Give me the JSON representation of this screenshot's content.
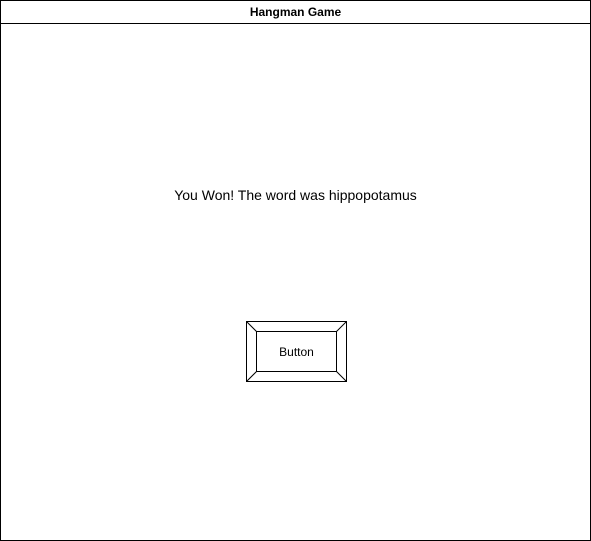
{
  "window": {
    "title": "Hangman Game"
  },
  "main": {
    "message": "You Won! The word was hippopotamus",
    "button_label": "Button"
  }
}
